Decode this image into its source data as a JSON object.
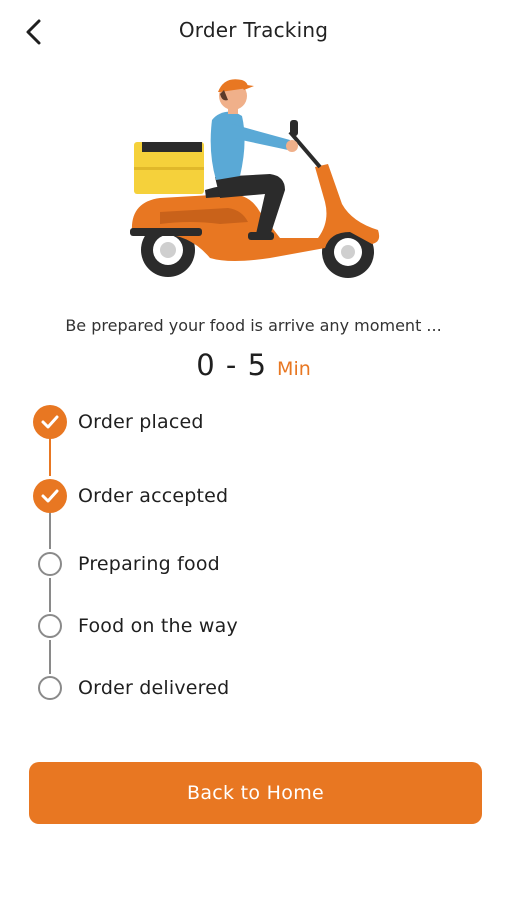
{
  "header": {
    "title": "Order Tracking",
    "back_icon": "chevron-left-icon"
  },
  "hero": {
    "illustration": "delivery-scooter-illustration",
    "colors": {
      "scooter": "#e87722",
      "box": "#f5d13b",
      "shirt": "#5aa9d6"
    }
  },
  "status": {
    "message": "Be prepared your food is arrive any moment ...",
    "eta_value": "0 - 5",
    "eta_unit": "Min"
  },
  "steps": [
    {
      "label": "Order placed",
      "done": true
    },
    {
      "label": "Order accepted",
      "done": true
    },
    {
      "label": "Preparing food",
      "done": false
    },
    {
      "label": "Food on the way",
      "done": false
    },
    {
      "label": "Order delivered",
      "done": false
    }
  ],
  "actions": {
    "back_home_label": "Back to Home"
  },
  "colors": {
    "accent": "#e87722",
    "pending": "#8a8a8a"
  }
}
